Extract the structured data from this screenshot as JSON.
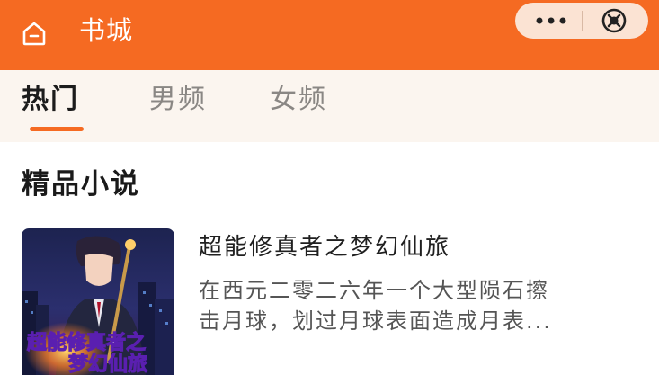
{
  "header": {
    "title": "书城",
    "home_icon": "home-icon",
    "more_icon": "more-dots-icon",
    "close_icon": "close-circle-icon",
    "background": "#f56a22"
  },
  "tabs": [
    {
      "label": "热门",
      "active": true
    },
    {
      "label": "男频",
      "active": false
    },
    {
      "label": "女频",
      "active": false
    }
  ],
  "section": {
    "title": "精品小说"
  },
  "books": [
    {
      "title": "超能修真者之梦幻仙旅",
      "description_line1": "在西元二零二六年一个大型陨石擦",
      "description_line2": "击月球，划过月球表面造成月表...",
      "cover_text_line1": "超能修真者之",
      "cover_text_line2": "梦幻仙旅"
    }
  ],
  "colors": {
    "accent": "#f56a22",
    "tab_bar_bg": "#fbf5ef",
    "capsule_bg": "#fbe3d3"
  }
}
